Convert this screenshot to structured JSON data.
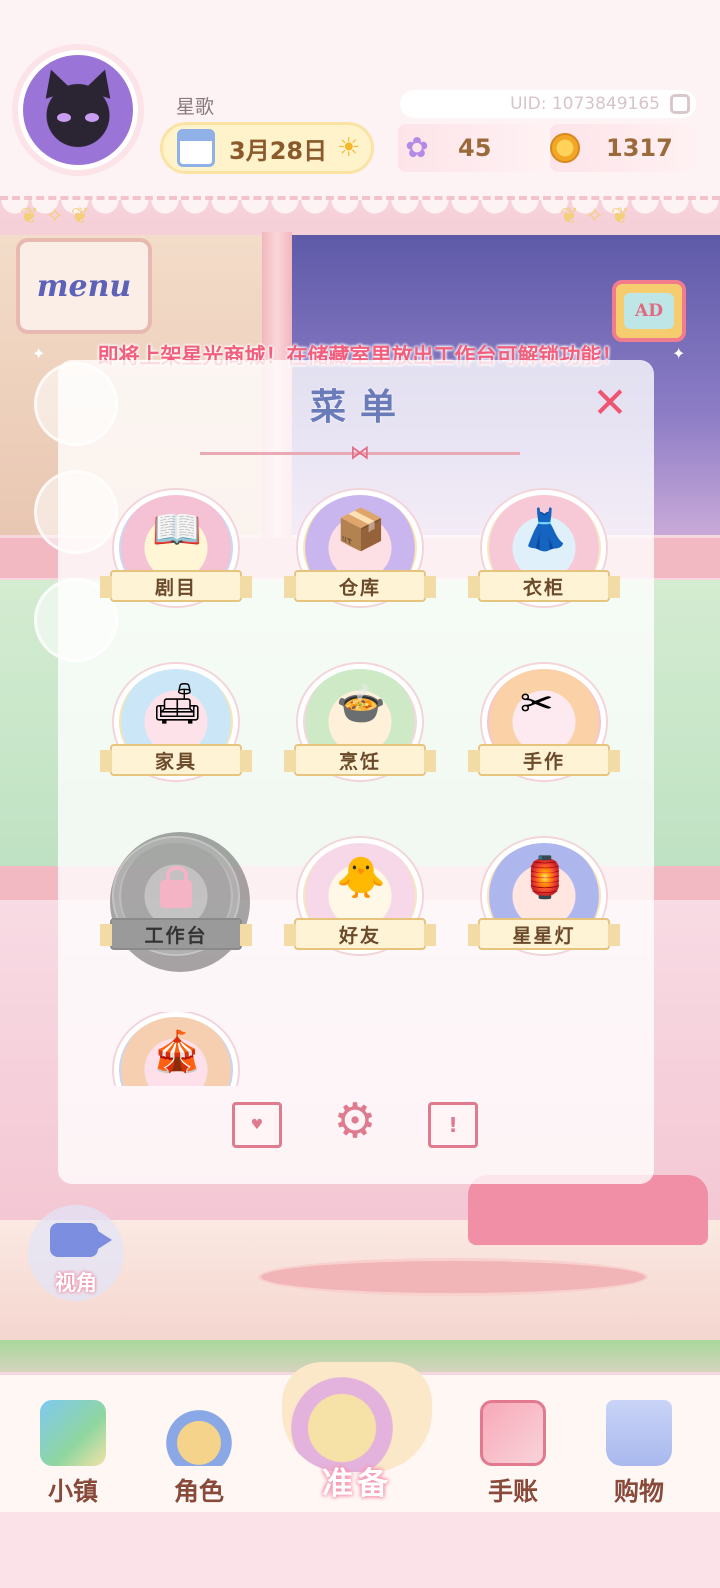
{
  "header": {
    "player_name": "星歌",
    "uid": "UID: 1073849165",
    "date": "3月28日",
    "gems": "45",
    "coins": "1317"
  },
  "side": {
    "menu_label": "menu",
    "ad_label": "AD"
  },
  "notice": "即将上架星光商城！在储藏室里放出工作台可解锁功能！",
  "menu": {
    "title": "菜单",
    "close_glyph": "✕",
    "items": [
      {
        "label": "剧目",
        "icon": "book-quill-icon",
        "locked": false
      },
      {
        "label": "仓库",
        "icon": "storage-box-icon",
        "locked": false
      },
      {
        "label": "衣柜",
        "icon": "dress-icon",
        "locked": false
      },
      {
        "label": "家具",
        "icon": "armchair-icon",
        "locked": false
      },
      {
        "label": "烹饪",
        "icon": "cooking-bowl-icon",
        "locked": false
      },
      {
        "label": "手作",
        "icon": "scissors-icon",
        "locked": false
      },
      {
        "label": "工作台",
        "icon": "workbench-icon",
        "locked": true
      },
      {
        "label": "好友",
        "icon": "friends-icon",
        "locked": false
      },
      {
        "label": "星星灯",
        "icon": "star-lamp-icon",
        "locked": false
      }
    ],
    "bottom_icons": [
      "mail-icon",
      "settings-gear-icon",
      "announcement-icon"
    ]
  },
  "view_button": {
    "label": "视角"
  },
  "nav": {
    "items": [
      {
        "label": "小镇",
        "icon": "town-map-icon"
      },
      {
        "label": "角色",
        "icon": "character-icon"
      },
      {
        "label": "准备",
        "icon": "basket-icon"
      },
      {
        "label": "手账",
        "icon": "journal-icon"
      },
      {
        "label": "购物",
        "icon": "shopping-bag-icon"
      }
    ]
  },
  "colors": {
    "accent_pink": "#f25f7d",
    "title_blue": "#6a7bb9",
    "ribbon_gold": "#e7c47d"
  }
}
